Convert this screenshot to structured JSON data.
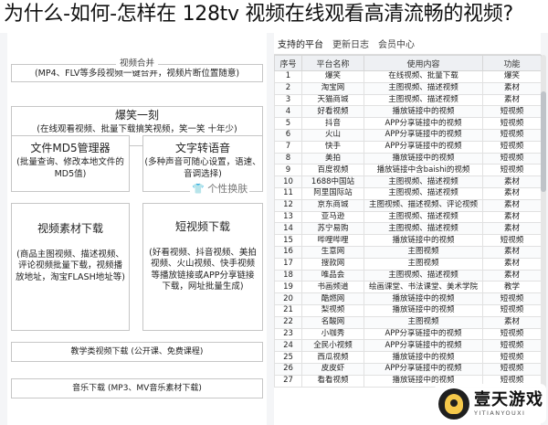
{
  "headline": "为什么-如何-怎样在 128tv 视频在线观看高清流畅的视频?",
  "left_panel": {
    "merge": {
      "legend": "视频合并",
      "text": "(MP4、FLV等多段视频一键合并，视频片断位置随意)"
    },
    "laugh": {
      "title": "爆笑一刻",
      "text": "(在线观看视频、批量下载搞笑视频，笑一笑 十年少)"
    },
    "md5": {
      "title": "文件MD5管理器",
      "text": "(批量查询、修改本地文件的MD5值)"
    },
    "tts": {
      "title": "文字转语音",
      "text": "(多种声音可随心设置，语速、音调选择)"
    },
    "theme_switch": "个性换肤",
    "material": {
      "title": "视频素材下载",
      "text": "(商品主图视频、描述视频、评论视频批量下载，视频播放地址，淘宝FLASH地址等)"
    },
    "short_video": {
      "title": "短视频下载",
      "text": "(好看视频、抖音视频、美拍视频、火山视频、快手视频等播放链接或APP分享链接下载，网址批量生成)"
    },
    "edu": "教学类视频下载 (公开课、免费课程)",
    "music": "音乐下载 (MP3、MV音乐素材下载)"
  },
  "tabs": [
    "支持的平台",
    "更新日志",
    "会员中心"
  ],
  "table": {
    "headers": [
      "序号",
      "平台名称",
      "使用内容",
      "功能"
    ],
    "rows": [
      [
        "1",
        "爆笑",
        "在线视频、批量下载",
        "爆笑"
      ],
      [
        "2",
        "淘宝网",
        "主图视频、描述视频",
        "素材"
      ],
      [
        "3",
        "天猫商城",
        "主图视频、描述视频",
        "素材"
      ],
      [
        "4",
        "好看视频",
        "播放链接中的视频",
        "短视频"
      ],
      [
        "5",
        "抖音",
        "APP分享链接中的视频",
        "短视频"
      ],
      [
        "6",
        "火山",
        "APP分享链接中的视频",
        "短视频"
      ],
      [
        "7",
        "快手",
        "APP分享链接中的视频",
        "短视频"
      ],
      [
        "8",
        "美拍",
        "播放链接中的视频",
        "短视频"
      ],
      [
        "9",
        "百度视频",
        "播放链接中含baishi的视频",
        "短视频"
      ],
      [
        "10",
        "1688中国站",
        "主图视频、描述视频",
        "素材"
      ],
      [
        "11",
        "阿里国际站",
        "主图视频、描述视频",
        "素材"
      ],
      [
        "12",
        "京东商城",
        "主图视频、描述视频、评论视频",
        "素材"
      ],
      [
        "13",
        "亚马逊",
        "主图视频、描述视频",
        "素材"
      ],
      [
        "14",
        "苏宁易购",
        "主图视频、描述视频",
        "素材"
      ],
      [
        "15",
        "哔哩哔哩",
        "播放链接中的视频",
        "短视频"
      ],
      [
        "16",
        "生意网",
        "主图视频",
        "素材"
      ],
      [
        "17",
        "搜款网",
        "主图视频",
        "素材"
      ],
      [
        "18",
        "唯品会",
        "主图视频、描述视频",
        "素材"
      ],
      [
        "19",
        "书画频道",
        "绘画课堂、书法课堂、美术学院",
        "教学"
      ],
      [
        "20",
        "酷燃网",
        "播放链接中的视频",
        "短视频"
      ],
      [
        "21",
        "梨视频",
        "播放链接中的视频",
        "短视频"
      ],
      [
        "22",
        "名酸网",
        "主图视频",
        "素材"
      ],
      [
        "23",
        "小咖秀",
        "APP分享链接中的视频",
        "短视频"
      ],
      [
        "24",
        "全民小视频",
        "APP分享链接中的视频",
        "短视频"
      ],
      [
        "25",
        "西瓜视频",
        "播放链接中的视频",
        "短视频"
      ],
      [
        "26",
        "皮皮虾",
        "APP分享链接中的视频",
        "短视频"
      ],
      [
        "27",
        "看看视频",
        "播放链接中的视频",
        "短视频"
      ]
    ]
  },
  "badge": {
    "name": "壹天游戏",
    "sub": "YITIANYOUXI"
  }
}
